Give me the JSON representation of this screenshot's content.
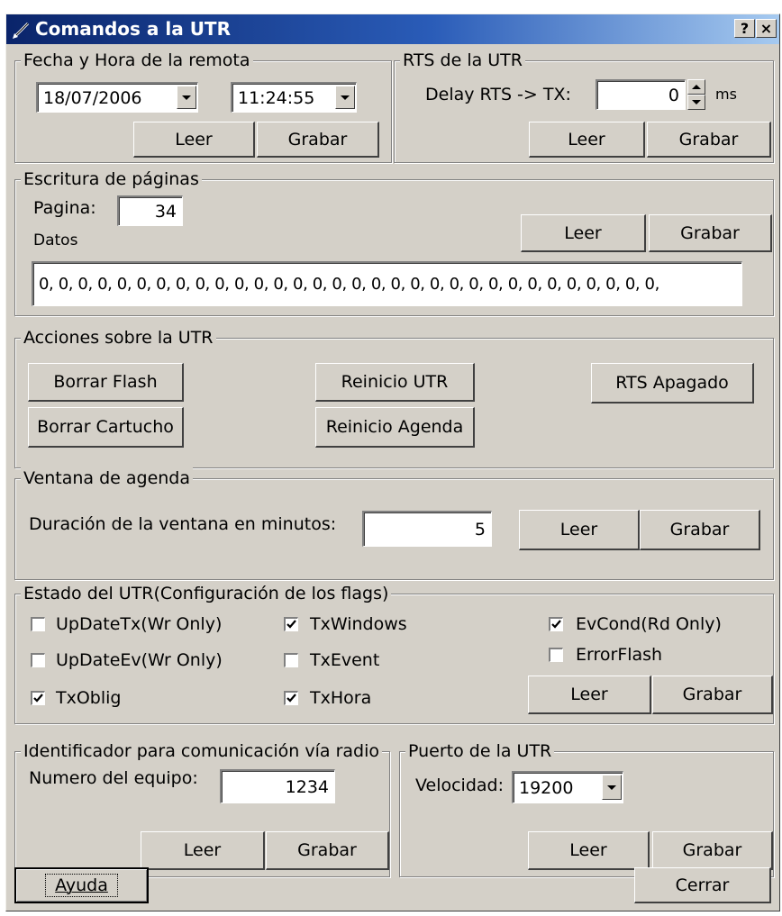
{
  "window": {
    "title": "Comandos a la UTR",
    "help_label": "?",
    "close_label": "×"
  },
  "fecha_hora": {
    "legend": "Fecha y Hora de la remota",
    "date": "18/07/2006",
    "time": "11:24:55",
    "read_label": "Leer",
    "write_label": "Grabar"
  },
  "rts": {
    "legend": "RTS de la UTR",
    "delay_label": "Delay RTS -> TX:",
    "delay_value": "0",
    "unit": "ms",
    "read_label": "Leer",
    "write_label": "Grabar"
  },
  "paginas": {
    "legend": "Escritura de páginas",
    "page_label": "Pagina:",
    "page_value": "34",
    "data_label": "Datos",
    "data_value": "0, 0, 0, 0, 0, 0, 0, 0, 0, 0, 0, 0, 0, 0, 0, 0, 0, 0, 0, 0, 0, 0, 0, 0, 0, 0, 0, 0, 0, 0, 0, 0,",
    "read_label": "Leer",
    "write_label": "Grabar"
  },
  "acciones": {
    "legend": "Acciones sobre la UTR",
    "borrar_flash": "Borrar Flash",
    "borrar_cartucho": "Borrar Cartucho",
    "reinicio_utr": "Reinicio UTR",
    "reinicio_agenda": "Reinicio Agenda",
    "rts_apagado": "RTS Apagado"
  },
  "agenda": {
    "legend": "Ventana de agenda",
    "duration_label": "Duración de la ventana en minutos:",
    "duration_value": "5",
    "read_label": "Leer",
    "write_label": "Grabar"
  },
  "estado": {
    "legend": "Estado del UTR(Configuración de los flags)",
    "flags": {
      "updatetx": {
        "label": "UpDateTx(Wr Only)",
        "checked": false
      },
      "updateev": {
        "label": "UpDateEv(Wr Only)",
        "checked": false
      },
      "txoblig": {
        "label": "TxOblig",
        "checked": true
      },
      "txwindows": {
        "label": "TxWindows",
        "checked": true
      },
      "txevent": {
        "label": "TxEvent",
        "checked": false
      },
      "txhora": {
        "label": "TxHora",
        "checked": true
      },
      "evcond": {
        "label": "EvCond(Rd Only)",
        "checked": true
      },
      "errorflash": {
        "label": "ErrorFlash",
        "checked": false
      }
    },
    "read_label": "Leer",
    "write_label": "Grabar"
  },
  "radio": {
    "legend": "Identificador para comunicación vía radio",
    "number_label": "Numero del equipo:",
    "number_value": "1234",
    "read_label": "Leer",
    "write_label": "Grabar"
  },
  "puerto": {
    "legend": "Puerto de la UTR",
    "speed_label": "Velocidad:",
    "speed_value": "19200",
    "read_label": "Leer",
    "write_label": "Grabar"
  },
  "footer": {
    "help_label": "Ayuda",
    "close_label": "Cerrar"
  }
}
